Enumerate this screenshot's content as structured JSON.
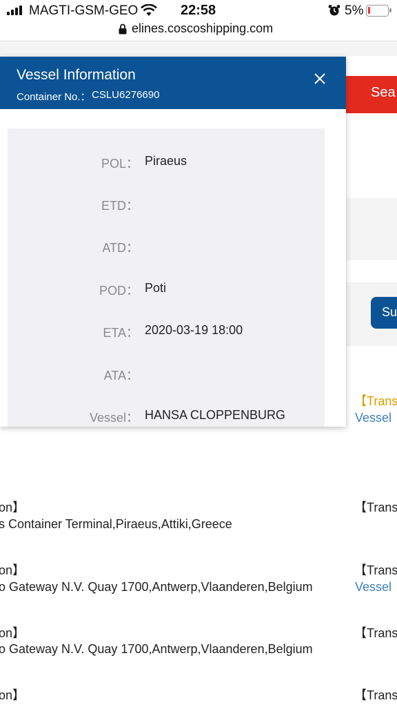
{
  "status_bar": {
    "carrier": "MAGTI-GSM-GEO",
    "time": "22:58",
    "battery_percent": "5%",
    "battery_color": "#e53935"
  },
  "browser": {
    "url": "elines.coscoshipping.com"
  },
  "page": {
    "search_button": "Sea",
    "submit_button": "Su",
    "accent_red": "#e32a1f",
    "accent_blue": "#0b5394",
    "right_col": {
      "transp_yellow": "【Transp",
      "vessel_link_1": "Vessel",
      "transp_2": "【Transp",
      "transp_3": "【Transp",
      "vessel_link_2": "Vessel",
      "transp_4": "【Transp",
      "transp_5": "【Transp"
    },
    "routes": [
      {
        "heading": "on】",
        "text": "s Container Terminal,Piraeus,Attiki,Greece"
      },
      {
        "heading": "on】",
        "text": "o Gateway N.V. Quay 1700,Antwerp,Vlaanderen,Belgium"
      },
      {
        "heading": "on】",
        "text": "o Gateway N.V. Quay 1700,Antwerp,Vlaanderen,Belgium"
      },
      {
        "heading": "on】",
        "text": ""
      }
    ]
  },
  "modal": {
    "title": "Vessel Information",
    "container_label": "Container No.：",
    "container_no": "CSLU6276690",
    "close_icon": "close-icon",
    "rows": [
      {
        "label": "POL：",
        "value": "Piraeus"
      },
      {
        "label": "ETD：",
        "value": ""
      },
      {
        "label": "ATD：",
        "value": ""
      },
      {
        "label": "POD：",
        "value": "Poti"
      },
      {
        "label": "ETA：",
        "value": "2020-03-19 18:00"
      },
      {
        "label": "ATA：",
        "value": ""
      },
      {
        "label": "Vessel：",
        "value": "HANSA CLOPPENBURG"
      }
    ]
  }
}
